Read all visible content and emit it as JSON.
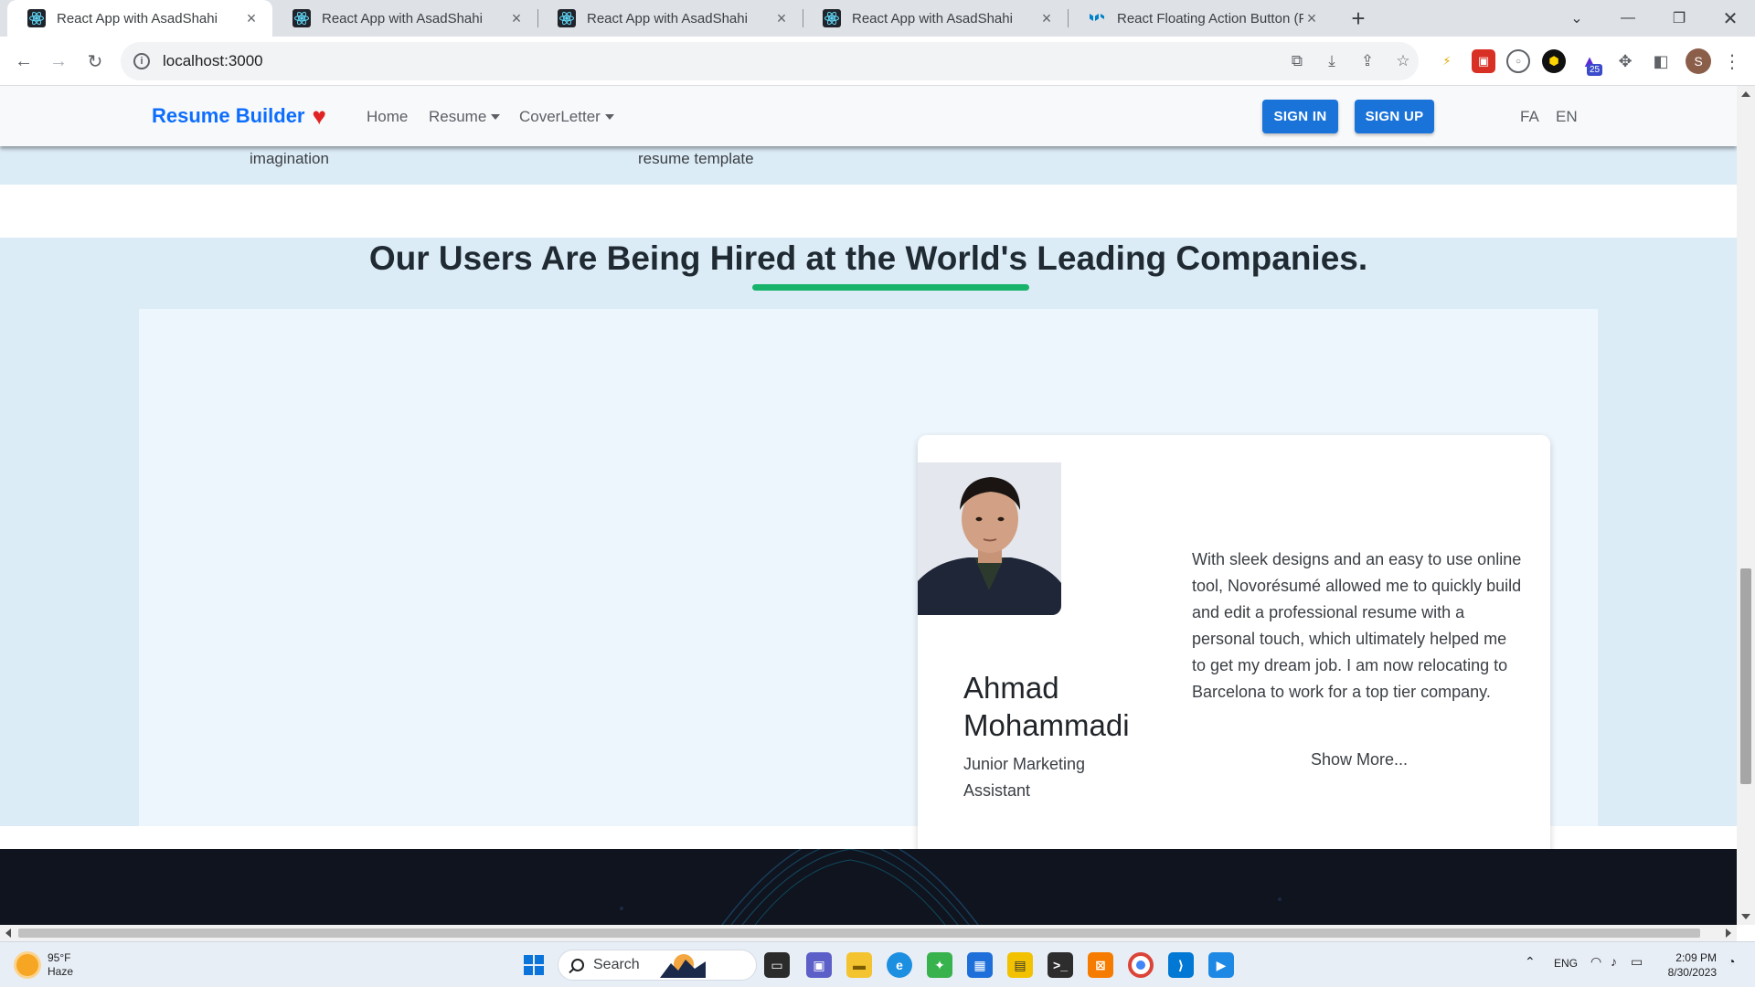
{
  "browser": {
    "tabs": [
      {
        "title": "React App with AsadShahi",
        "active": true
      },
      {
        "title": "React App with AsadShahi",
        "active": false
      },
      {
        "title": "React App with AsadShahi",
        "active": false
      },
      {
        "title": "React App with AsadShahi",
        "active": false
      },
      {
        "title": "React Floating Action Button (FAB",
        "active": false
      }
    ],
    "address": {
      "url": "localhost:3000"
    },
    "profile_initial": "S",
    "badge_count": "25"
  },
  "site": {
    "brand": "Resume Builder",
    "nav": {
      "home": "Home",
      "resume": "Resume",
      "coverletter": "CoverLetter"
    },
    "buttons": {
      "signin": "SIGN IN",
      "signup": "SIGN UP"
    },
    "languages": {
      "fa": "FA",
      "en": "EN"
    },
    "partial_text": {
      "left": "imagination",
      "right": "resume template"
    },
    "testimonials": {
      "title": "Our Users Are Being Hired at the World's Leading Companies.",
      "card": {
        "name": "Ahmad Mohammadi",
        "role": "Junior Marketing Assistant",
        "quote": "With sleek designs and an easy to use online tool, Novorésumé allowed me to quickly build and edit a professional resume with a personal touch, which ultimately helped me to get my dream job. I am now relocating to Barcelona to work for a top tier company.",
        "more": "Show More..."
      }
    }
  },
  "taskbar": {
    "weather": {
      "temp": "95°F",
      "condition": "Haze"
    },
    "search_label": "Search",
    "language": "ENG",
    "time": "2:09 PM",
    "date": "8/30/2023"
  },
  "colors": {
    "brand_blue": "#0d6efd",
    "button_blue": "#1a73d9",
    "accent_green": "#17b36b",
    "section_bg": "#dcecf7",
    "footer_bg": "#0f141f"
  }
}
